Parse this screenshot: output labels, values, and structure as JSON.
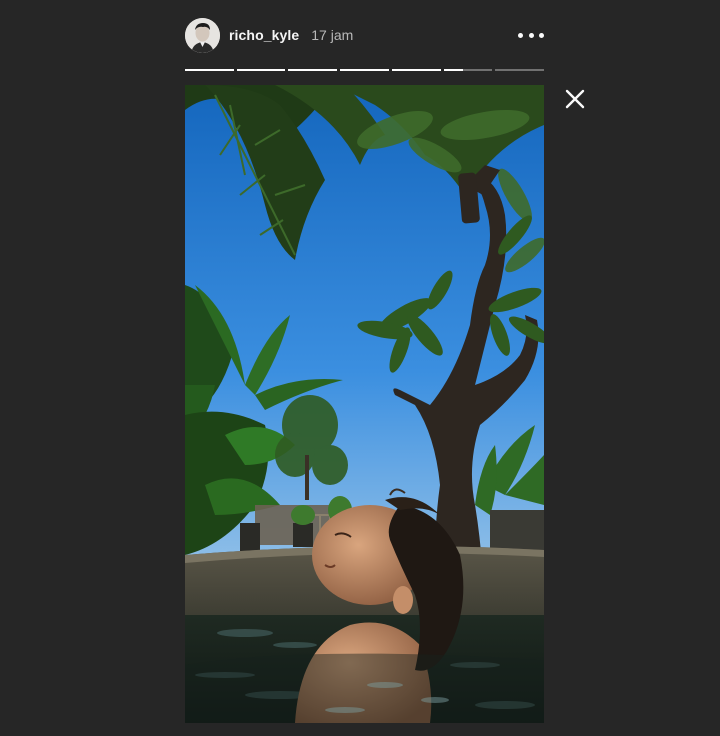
{
  "story": {
    "username": "richo_kyle",
    "time_ago": "17 jam",
    "segments_total": 7,
    "current_segment": 6,
    "current_segment_progress": 0.4
  },
  "icons": {
    "avatar": "profile-avatar",
    "more": "more-options-icon",
    "close": "close-icon"
  },
  "colors": {
    "background": "#262626",
    "text_primary": "#f5f5f5",
    "text_secondary": "#b8b8b8"
  }
}
